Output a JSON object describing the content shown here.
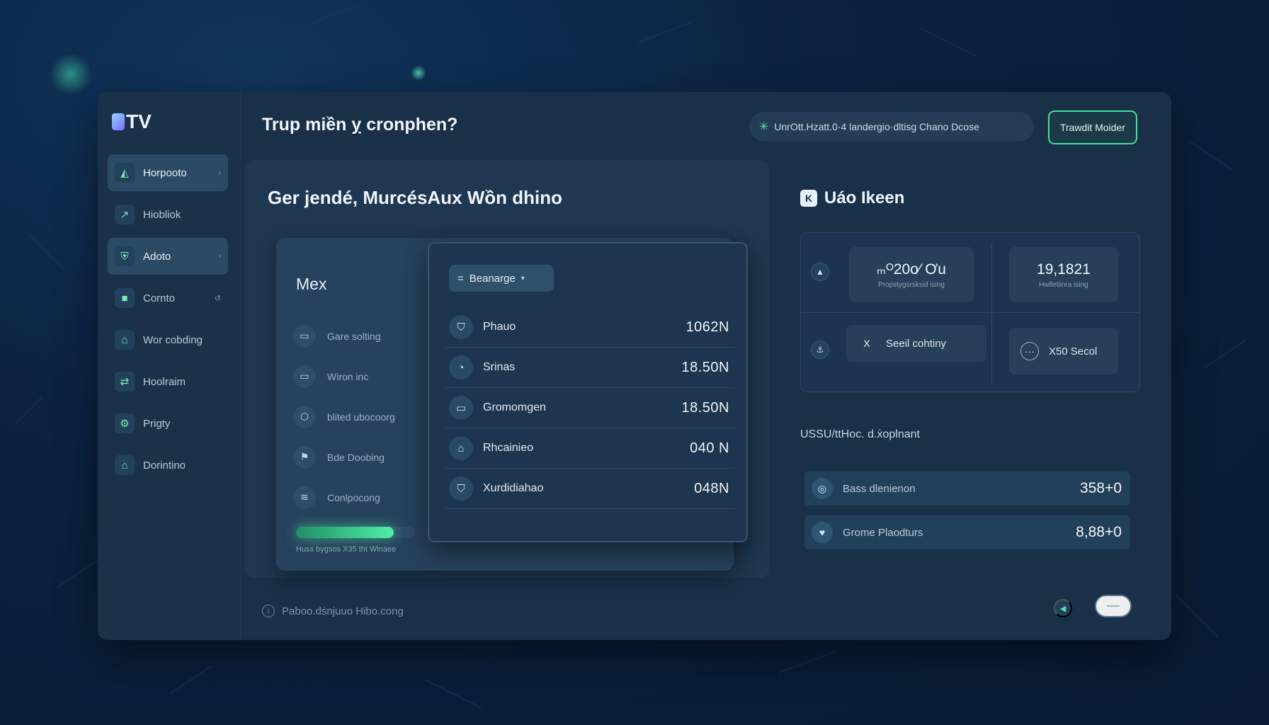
{
  "app": {
    "logo_text": "TV"
  },
  "sidebar": {
    "items": [
      {
        "label": "Horpooto",
        "icon": "chart-icon",
        "glyph": "◭",
        "active": true
      },
      {
        "label": "Hiobliok",
        "icon": "trend-icon",
        "glyph": "↗",
        "active": false
      },
      {
        "label": "Adoto",
        "icon": "shield-icon",
        "glyph": "⛨",
        "active": true
      },
      {
        "label": "Cornto",
        "icon": "square-icon",
        "glyph": "■",
        "active": false
      },
      {
        "label": "Wor cobding",
        "icon": "bank-icon",
        "glyph": "⌂",
        "active": false
      },
      {
        "label": "Hoolraim",
        "icon": "user-swap-icon",
        "glyph": "⇄",
        "active": false
      },
      {
        "label": "Prigty",
        "icon": "settings-icon",
        "glyph": "⚙",
        "active": false
      },
      {
        "label": "Dorintino",
        "icon": "home-icon",
        "glyph": "⌂",
        "active": false
      }
    ]
  },
  "header": {
    "title": "Trup miền ỵ cronphen?",
    "status_text": "UnrOtt.Hzatt.0·4 landergio·dltisg Chano Dcose",
    "action_button": "Trawdit Moider"
  },
  "center": {
    "heading": "Ger jendé, MurcésAux Wồn dhino",
    "back_card": {
      "title": "Mex",
      "rows": [
        {
          "label": "Gare solting",
          "glyph": "▭"
        },
        {
          "label": "Wiron inc",
          "glyph": "▭"
        },
        {
          "label": "blited ubocoorg",
          "glyph": "⬡"
        },
        {
          "label": "Bde Doobing",
          "glyph": "⚑"
        },
        {
          "label": "Conlpocong",
          "glyph": "≋"
        }
      ],
      "progress": 0.82,
      "caption": "Huss bygsos X35 tht Winaee"
    },
    "front_card": {
      "dropdown_label": "Beanarge",
      "rows": [
        {
          "label": "Phauo",
          "value": "1062N",
          "glyph": "⛉"
        },
        {
          "label": "Srinas",
          "value": "18.50N",
          "glyph": "◔"
        },
        {
          "label": "Gromomgen",
          "value": "18.50N",
          "glyph": "▭"
        },
        {
          "label": "Rhcainieo",
          "value": "040 N",
          "glyph": "⌂"
        },
        {
          "label": "Xurdidiahao",
          "value": "048N",
          "glyph": "⛉"
        }
      ]
    }
  },
  "right": {
    "heading": "Uáo Ikeen",
    "stats": [
      {
        "value": "ₘᴼ20o⁄ Ơu",
        "label": "Propstygsrsksid ising"
      },
      {
        "value": "19,1821",
        "label": "Hwlletiinra ising"
      }
    ],
    "actions": [
      {
        "label": "Seeil cohtiny",
        "glyph": "X"
      },
      {
        "label": "X50 Secol",
        "glyph": "···"
      }
    ],
    "summary_label": "USSU/ttHoc. d.ẋoplnant",
    "summary_rows": [
      {
        "label": "Bass dlenienon",
        "value": "358+0",
        "glyph": "◎"
      },
      {
        "label": "Grome Plaodturs",
        "value": "8,88+0",
        "glyph": "♥"
      }
    ]
  },
  "footer": {
    "text": "Paboo.dṡnjuuo Hibo.cong"
  },
  "colors": {
    "accent": "#42e0a0",
    "panel": "#1a2f48",
    "background": "#0b2240"
  }
}
